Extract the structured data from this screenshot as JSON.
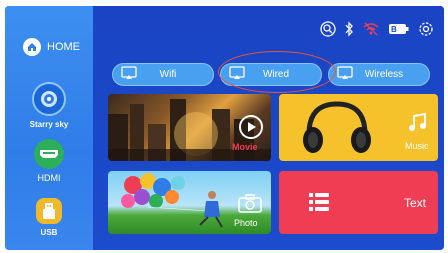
{
  "sidebar": {
    "home_label": "HOME",
    "items": [
      {
        "label": "Starry sky",
        "icon": "starry-sky-icon"
      },
      {
        "label": "HDMI",
        "icon": "hdmi-icon"
      },
      {
        "label": "USB",
        "icon": "usb-icon"
      }
    ]
  },
  "status_bar": {
    "icons": [
      "search-icon",
      "bluetooth-icon",
      "wifi-icon",
      "battery-icon",
      "settings-icon"
    ]
  },
  "tabs": [
    {
      "label": "Wifi",
      "icon": "cast-icon"
    },
    {
      "label": "Wired",
      "icon": "cast-icon",
      "highlighted": true
    },
    {
      "label": "Wireless",
      "icon": "cast-icon"
    }
  ],
  "tiles": {
    "movie": {
      "label": "Movie",
      "icon": "play-icon"
    },
    "music": {
      "label": "Music",
      "icon": "music-note-icon"
    },
    "photo": {
      "label": "Photo",
      "icon": "camera-icon"
    },
    "text": {
      "label": "Text",
      "icon": "document-icon"
    }
  },
  "colors": {
    "sidebar": "#3686ee",
    "main": "#1c48c8",
    "music_tile": "#f6c22c",
    "text_tile": "#ef3e54",
    "highlight_ring": "#e5533d"
  }
}
